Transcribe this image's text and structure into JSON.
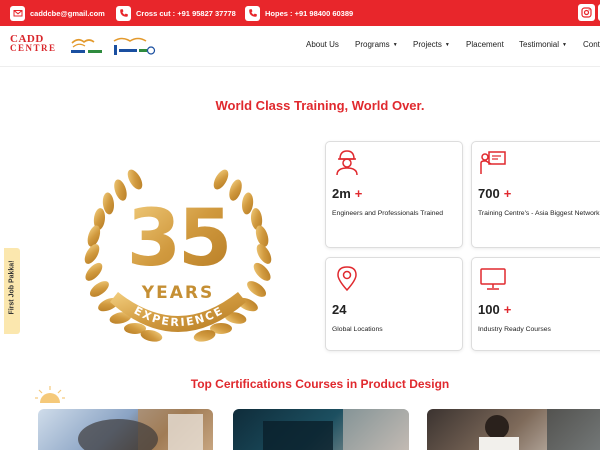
{
  "topbar": {
    "email": "caddcbe@gmail.com",
    "phone_cross_cut": "Cross cut : +91 95827 37778",
    "phone_hopes": "Hopes : +91 98400 60389"
  },
  "logo": {
    "line1": "CADD",
    "line2": "CENTRE"
  },
  "nav": {
    "about": "About Us",
    "programs": "Programs",
    "projects": "Projects",
    "placement": "Placement",
    "testimonial": "Testimonial",
    "contact": "Cont"
  },
  "headline": "World Class Training, World Over.",
  "badge": {
    "number": "35",
    "years": "YEARS",
    "experience": "EXPERIENCE"
  },
  "stats": [
    {
      "number": "2m",
      "plus": "+",
      "label": "Engineers and Professionals Trained",
      "icon": "engineer-icon"
    },
    {
      "number": "700",
      "plus": "+",
      "label": "Training Centre's - Asia Biggest Network",
      "icon": "trainer-board-icon"
    },
    {
      "number": "24",
      "plus": "",
      "label": "Global Locations",
      "icon": "location-pin-icon"
    },
    {
      "number": "100",
      "plus": "+",
      "label": "Industry Ready Courses",
      "icon": "monitor-icon"
    }
  ],
  "side_tab": "First Job Pakka!",
  "courses_title": "Top Certifications Courses in Product Design",
  "colors": {
    "brand_red": "#e8262b",
    "gold": "#d4a146",
    "side_tab": "#fbe7ae"
  }
}
